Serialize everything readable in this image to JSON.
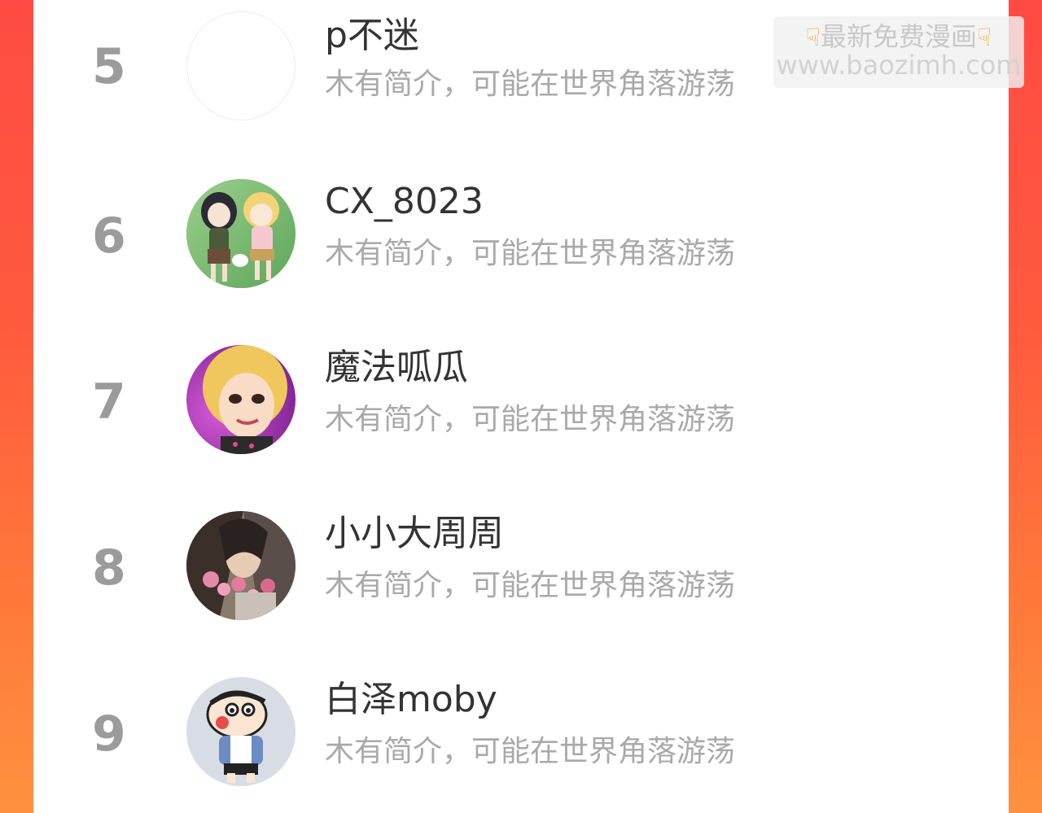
{
  "ranking": [
    {
      "rank": "5",
      "name": "p不迷",
      "intro": "木有简介，可能在世界角落游荡",
      "avatar_icon": "empty-avatar-icon"
    },
    {
      "rank": "6",
      "name": "CX_8023",
      "intro": "木有简介，可能在世界角落游荡",
      "avatar_icon": "anime-girls-avatar-icon"
    },
    {
      "rank": "7",
      "name": "魔法呱瓜",
      "intro": "木有简介，可能在世界角落游荡",
      "avatar_icon": "blonde-girl-avatar-icon"
    },
    {
      "rank": "8",
      "name": "小小大周周",
      "intro": "木有简介，可能在世界角落游荡",
      "avatar_icon": "illustration-avatar-icon"
    },
    {
      "rank": "9",
      "name": "白泽moby",
      "intro": "木有简介，可能在世界角落游荡",
      "avatar_icon": "cartoon-boy-avatar-icon"
    }
  ],
  "watermark": {
    "title": "最新免费漫画",
    "url": "www.baozimh.com",
    "hand_icon": "pointing-down-hand-icon"
  },
  "colors": {
    "background_top": "#ff4b43",
    "background_bottom": "#ff9140",
    "rank_color": "#9b9b9b",
    "name_color": "#333333",
    "intro_color": "#a9a9a9"
  }
}
